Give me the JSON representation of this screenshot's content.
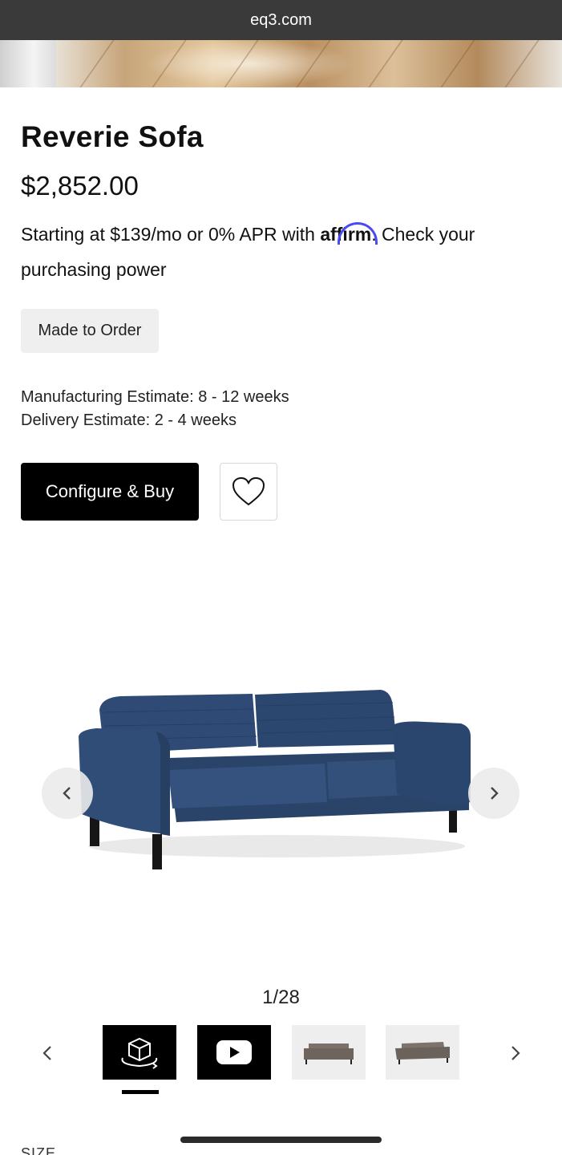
{
  "browser": {
    "url": "eq3.com"
  },
  "product": {
    "title": "Reverie Sofa",
    "price": "$2,852.00",
    "financing": {
      "prefix": "Starting at $139/mo or 0% APR with ",
      "brand": "affirm",
      "suffix": ". Check your purchasing power"
    },
    "badge": "Made to Order",
    "manufacturing_estimate": "Manufacturing Estimate: 8 - 12 weeks",
    "delivery_estimate": "Delivery Estimate: 2 - 4 weeks",
    "buy_label": "Configure & Buy"
  },
  "gallery": {
    "counter": "1/28",
    "thumbnails": [
      {
        "icon": "3d-cube-icon",
        "selected": true
      },
      {
        "icon": "play-video-icon",
        "selected": false
      },
      {
        "icon": "sofa-grey-thumbnail",
        "selected": false
      },
      {
        "icon": "sofa-grey-angle-thumbnail",
        "selected": false
      }
    ]
  },
  "section": {
    "next_label": "SIZE"
  },
  "colors": {
    "sofa_blue": "#2e4a73",
    "button_black": "#000000",
    "affirm_blue": "#4a4af4"
  }
}
